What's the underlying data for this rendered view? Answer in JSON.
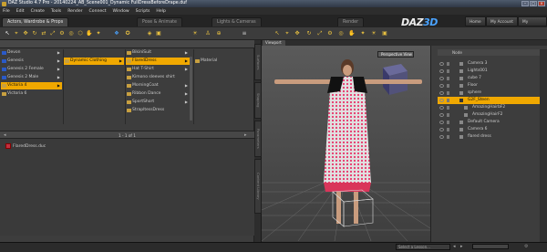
{
  "window": {
    "title": "DAZ Studio 4.7 Pro - 20140224_AB_Scene001_Dynamic FullDressBeforeDrape.duf"
  },
  "menu": [
    "File",
    "Edit",
    "Create",
    "Tools",
    "Render",
    "Connect",
    "Window",
    "Scripts",
    "Help"
  ],
  "panel_tabs": {
    "left": "Actors, Wardrobe & Props",
    "center1": "Pose & Animate",
    "center2": "Lights & Cameras",
    "right": "Render"
  },
  "brand": {
    "logo_text": "DAZ",
    "logo_num": "3D"
  },
  "top_buttons": [
    "Home",
    "My Account",
    "My Gallery"
  ],
  "library": {
    "col1": [
      {
        "label": "Devon",
        "arrow": "▶",
        "selected": false
      },
      {
        "label": "Genesis",
        "arrow": "▶",
        "selected": false
      },
      {
        "label": "Genesis 2 Female",
        "arrow": "▶",
        "selected": false
      },
      {
        "label": "Genesis 2 Male",
        "arrow": "▶",
        "selected": false
      },
      {
        "label": "Victoria 4",
        "arrow": "▶",
        "selected": true
      },
      {
        "label": "Victoria 6",
        "arrow": "",
        "selected": false
      }
    ],
    "col2": [
      {
        "label": "Dynamic Clothing",
        "arrow": "▶",
        "selected": true
      }
    ],
    "col3": [
      {
        "label": "BikiniSuit",
        "arrow": "▶",
        "selected": false
      },
      {
        "label": "FlaredDress",
        "arrow": "▶",
        "selected": true
      },
      {
        "label": "Hat T-Shirt",
        "arrow": "▶",
        "selected": false
      },
      {
        "label": "Kimono sleeves shirt",
        "arrow": "",
        "selected": false
      },
      {
        "label": "MorningCoat",
        "arrow": "▶",
        "selected": false
      },
      {
        "label": "Ribbon Dance",
        "arrow": "▶",
        "selected": false
      },
      {
        "label": "SportShort",
        "arrow": "▶",
        "selected": false
      },
      {
        "label": "StrapltessDress",
        "arrow": "",
        "selected": false
      }
    ],
    "col4": [
      {
        "label": "Material",
        "arrow": "",
        "selected": false
      }
    ],
    "pager": "1 - 1 of 1",
    "asset": "FlaredDress.duc"
  },
  "side_tabs": [
    "Surfaces",
    "Shaping",
    "Parameters",
    "Content Library"
  ],
  "viewport": {
    "tab": "Viewport",
    "camera": "Perspective View"
  },
  "scene": {
    "header": "Node",
    "rows": [
      {
        "label": "Camera 3",
        "selected": false,
        "indent": 0
      },
      {
        "label": "Lights001",
        "selected": false,
        "indent": 0
      },
      {
        "label": "cube 7",
        "selected": false,
        "indent": 0
      },
      {
        "label": "Floor",
        "selected": false,
        "indent": 0
      },
      {
        "label": "sphere",
        "selected": false,
        "indent": 0
      },
      {
        "label": "G2F_Steen",
        "selected": true,
        "indent": 0
      },
      {
        "label": "AmazingHairbF2",
        "selected": false,
        "indent": 1
      },
      {
        "label": "AmazingHairF2",
        "selected": false,
        "indent": 1
      },
      {
        "label": "Default Camera",
        "selected": false,
        "indent": 0
      },
      {
        "label": "Camera 6",
        "selected": false,
        "indent": 0
      },
      {
        "label": "flared dress",
        "selected": false,
        "indent": 0
      }
    ]
  },
  "status": {
    "lesson_placeholder": "Select a Lesson..."
  },
  "colors": {
    "selection": "#f0a800",
    "accent_blue": "#2a5ac8",
    "dress": "#e03a5c"
  }
}
